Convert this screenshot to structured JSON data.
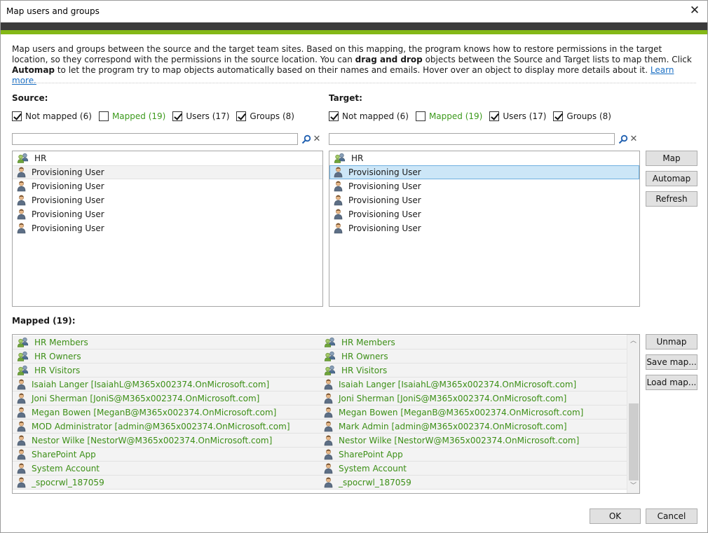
{
  "window": {
    "title": "Map users and groups",
    "close_glyph": "✕"
  },
  "description": {
    "part1": "Map users and groups between the source and the target team sites. Based on this mapping, the program knows how to restore permissions in the target location, so they correspond with the permissions in the source location. You can ",
    "bold1": "drag and drop",
    "part2": " objects between the Source and Target lists to map them. Click ",
    "bold2": "Automap",
    "part3": " to let the program try to map objects automatically based on their names and emails. Hover over an object to display more details about it. ",
    "link": "Learn more."
  },
  "source": {
    "label": "Source:",
    "filters": [
      {
        "label": "Not mapped (6)",
        "checked": true,
        "green": false
      },
      {
        "label": "Mapped (19)",
        "checked": false,
        "green": true
      },
      {
        "label": "Users (17)",
        "checked": true,
        "green": false
      },
      {
        "label": "Groups (8)",
        "checked": true,
        "green": false
      }
    ],
    "search_value": "",
    "items": [
      {
        "label": "HR",
        "icon": "group-icon"
      },
      {
        "label": "Provisioning User",
        "icon": "user-icon"
      },
      {
        "label": "Provisioning User",
        "icon": "user-icon"
      },
      {
        "label": "Provisioning User",
        "icon": "user-icon"
      },
      {
        "label": "Provisioning User",
        "icon": "user-icon"
      },
      {
        "label": "Provisioning User",
        "icon": "user-icon"
      }
    ]
  },
  "target": {
    "label": "Target:",
    "filters": [
      {
        "label": "Not mapped (6)",
        "checked": true,
        "green": false
      },
      {
        "label": "Mapped (19)",
        "checked": false,
        "green": true
      },
      {
        "label": "Users (17)",
        "checked": true,
        "green": false
      },
      {
        "label": "Groups (8)",
        "checked": true,
        "green": false
      }
    ],
    "search_value": "",
    "items": [
      {
        "label": "HR",
        "icon": "group-icon"
      },
      {
        "label": "Provisioning User",
        "icon": "user-icon"
      },
      {
        "label": "Provisioning User",
        "icon": "user-icon"
      },
      {
        "label": "Provisioning User",
        "icon": "user-icon"
      },
      {
        "label": "Provisioning User",
        "icon": "user-icon"
      },
      {
        "label": "Provisioning User",
        "icon": "user-icon"
      }
    ]
  },
  "buttons": {
    "map": "Map",
    "automap": "Automap",
    "refresh": "Refresh",
    "unmap": "Unmap",
    "save_map": "Save map...",
    "load_map": "Load map...",
    "ok": "OK",
    "cancel": "Cancel"
  },
  "mapped": {
    "label": "Mapped (19):",
    "rows": [
      {
        "source": "HR Members",
        "target": "HR Members",
        "icon": "group-icon"
      },
      {
        "source": "HR Owners",
        "target": "HR Owners",
        "icon": "group-icon"
      },
      {
        "source": "HR Visitors",
        "target": "HR Visitors",
        "icon": "group-icon"
      },
      {
        "source": "Isaiah Langer [IsaiahL@M365x002374.OnMicrosoft.com]",
        "target": "Isaiah Langer [IsaiahL@M365x002374.OnMicrosoft.com]",
        "icon": "user-icon"
      },
      {
        "source": "Joni Sherman [JoniS@M365x002374.OnMicrosoft.com]",
        "target": "Joni Sherman [JoniS@M365x002374.OnMicrosoft.com]",
        "icon": "user-icon"
      },
      {
        "source": "Megan Bowen [MeganB@M365x002374.OnMicrosoft.com]",
        "target": "Megan Bowen [MeganB@M365x002374.OnMicrosoft.com]",
        "icon": "user-icon"
      },
      {
        "source": "MOD Administrator [admin@M365x002374.OnMicrosoft.com]",
        "target": "Mark Admin [admin@M365x002374.OnMicrosoft.com]",
        "icon": "user-icon"
      },
      {
        "source": "Nestor Wilke [NestorW@M365x002374.OnMicrosoft.com]",
        "target": "Nestor Wilke [NestorW@M365x002374.OnMicrosoft.com]",
        "icon": "user-icon"
      },
      {
        "source": "SharePoint App",
        "target": "SharePoint App",
        "icon": "user-icon"
      },
      {
        "source": "System Account",
        "target": "System Account",
        "icon": "user-icon"
      },
      {
        "source": "_spocrwl_187059",
        "target": "_spocrwl_187059",
        "icon": "user-icon"
      }
    ]
  },
  "colors": {
    "accent_green": "#84b817",
    "mapped_text": "#3c8f16",
    "selection": "#cce6f7",
    "link": "#1a6fc4"
  }
}
